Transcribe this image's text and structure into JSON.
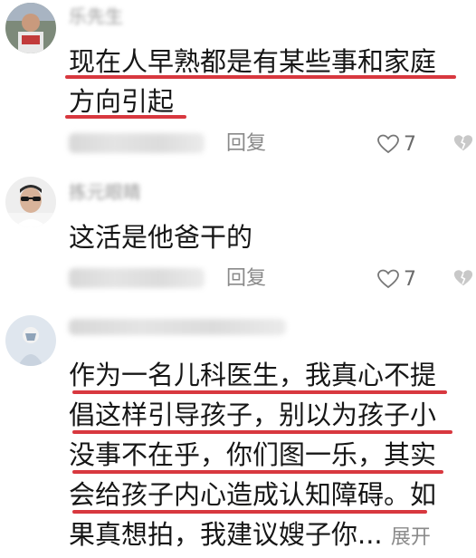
{
  "comments": [
    {
      "username": "乐先生",
      "lines": [
        "现在人早熟都是有某些事和家庭",
        "方向引起"
      ],
      "reply_label": "回复",
      "likes": "7"
    },
    {
      "username": "拣元眼睛",
      "lines": [
        "这活是他爸干的"
      ],
      "reply_label": "回复",
      "likes": "7"
    },
    {
      "username": "",
      "lines": [
        "作为一名儿科医生，我真心不提",
        "倡这样引导孩子，别以为孩子小",
        "没事不在乎，你们图一乐，其实",
        "会给孩子内心造成认知障碍。如",
        "果真想拍，我建议嫂子你..."
      ],
      "expand_label": "展开"
    }
  ],
  "colors": {
    "underline": "#d8383f",
    "meta": "#8a8a8a"
  }
}
